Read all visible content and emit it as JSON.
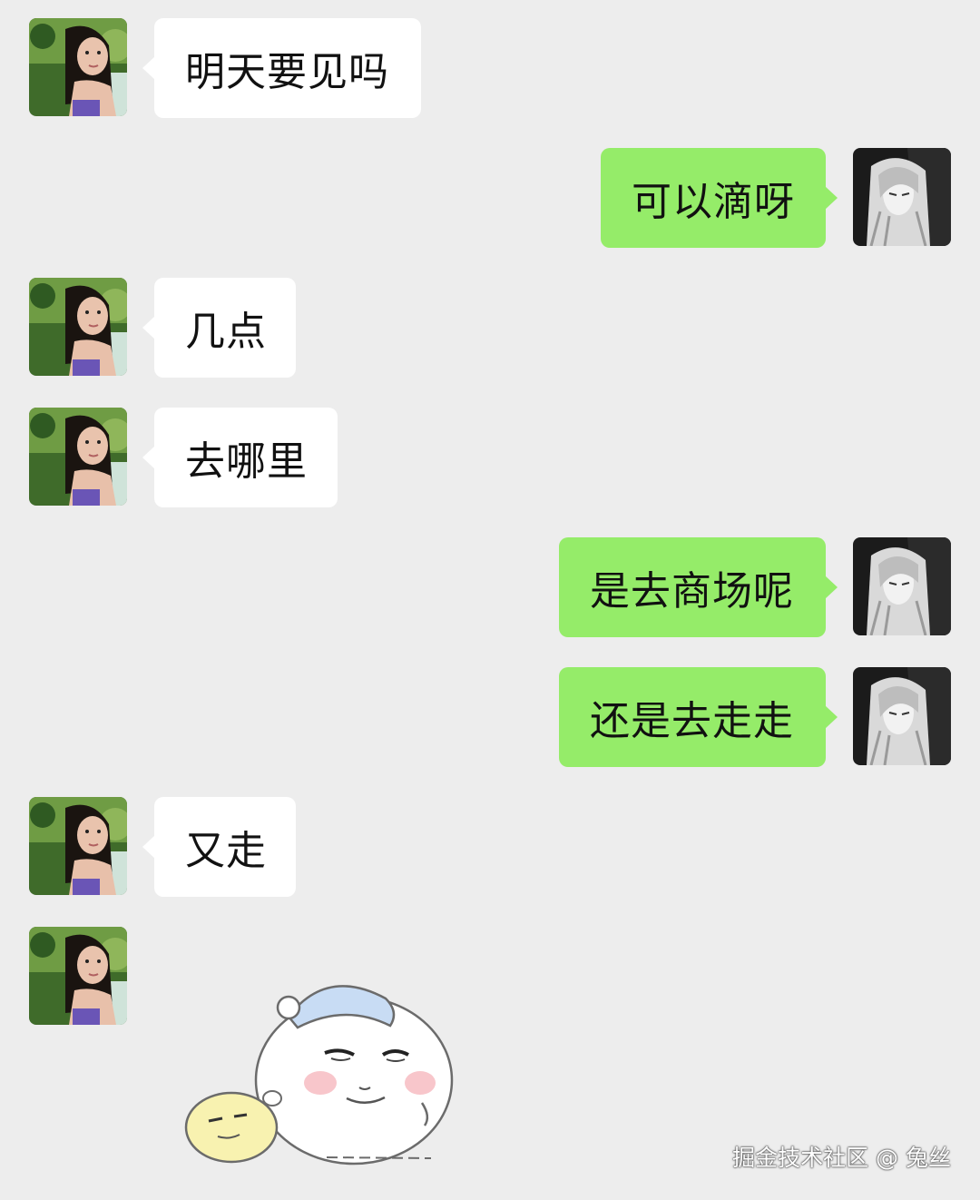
{
  "messages": [
    {
      "sender": "her",
      "text": "明天要见吗"
    },
    {
      "sender": "me",
      "text": "可以滴呀"
    },
    {
      "sender": "her",
      "text": "几点"
    },
    {
      "sender": "her",
      "text": "去哪里"
    },
    {
      "sender": "me",
      "text": "是去商场呢"
    },
    {
      "sender": "me",
      "text": "还是去走走"
    },
    {
      "sender": "her",
      "text": "又走"
    },
    {
      "sender": "her",
      "type": "sticker",
      "sticker": "white-hamster-smug-face-sticker"
    }
  ],
  "watermark": "掘金技术社区 @ 兔丝",
  "colors": {
    "background": "#ededed",
    "incoming_bubble": "#ffffff",
    "outgoing_bubble": "#95ec69",
    "text": "#111111"
  },
  "icons": {
    "her_avatar": "girl-photo-avatar",
    "my_avatar": "anime-white-hair-avatar"
  }
}
